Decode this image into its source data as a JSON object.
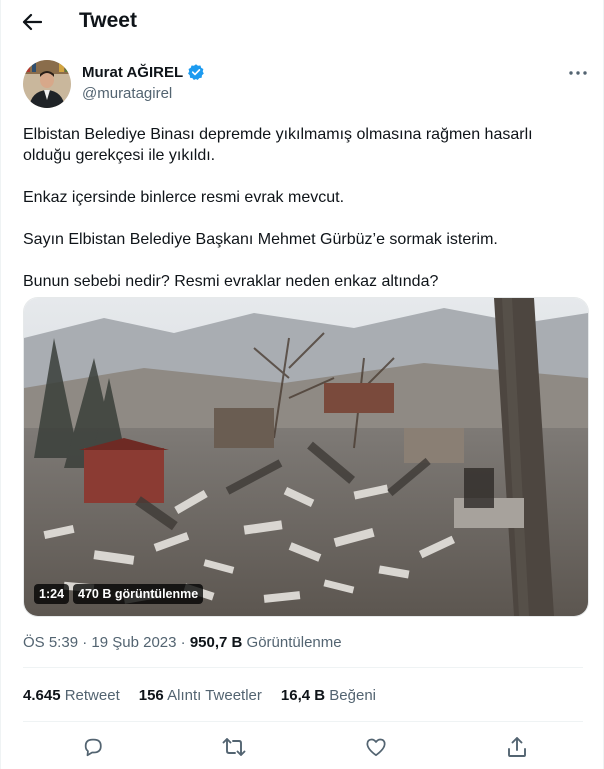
{
  "header": {
    "title": "Tweet"
  },
  "author": {
    "name": "Murat AĞIREL",
    "handle": "@muratagirel"
  },
  "tweet": {
    "paragraphs": [
      "Elbistan Belediye Binası depremde yıkılmamış olmasına rağmen hasarlı olduğu gerekçesi ile yıkıldı.",
      "Enkaz içersinde binlerce resmi evrak mevcut.",
      "Sayın Elbistan Belediye Başkanı Mehmet Gürbüz’e sormak isterim.",
      "Bunun sebebi nedir? Resmi evraklar neden enkaz altında?"
    ]
  },
  "media": {
    "duration": "1:24",
    "views": "470 B görüntülenme"
  },
  "meta": {
    "time": "ÖS 5:39",
    "separator": "·",
    "date": "19 Şub 2023",
    "views_count": "950,7 B",
    "views_label": "Görüntülenme"
  },
  "stats": {
    "retweets_count": "4.645",
    "retweets_label": "Retweet",
    "quotes_count": "156",
    "quotes_label": "Alıntı Tweetler",
    "likes_count": "16,4 B",
    "likes_label": "Beğeni"
  },
  "colors": {
    "accent": "#1d9bf0",
    "secondary_text": "#536471",
    "divider": "#eff3f4"
  },
  "icons": [
    "back-arrow-icon",
    "verified-badge-icon",
    "more-icon",
    "reply-icon",
    "retweet-icon",
    "like-icon",
    "share-icon"
  ]
}
